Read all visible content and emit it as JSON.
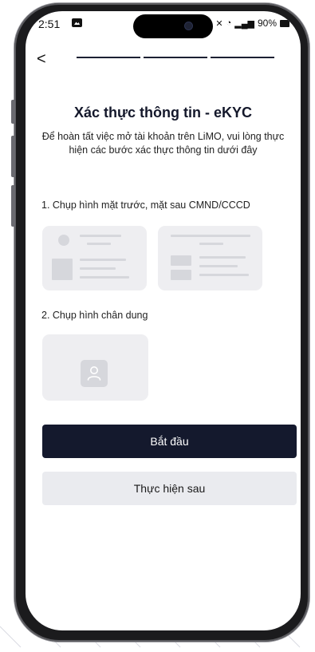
{
  "status_bar": {
    "time": "2:51",
    "battery": "90%",
    "icons": [
      "gallery-icon",
      "mute-icon",
      "wifi-icon",
      "signal-icon",
      "battery-icon"
    ]
  },
  "header": {
    "back_label": "<",
    "progress_steps": 3,
    "current_step": 1
  },
  "page": {
    "title": "Xác thực thông tin - eKYC",
    "subtitle": "Để hoàn tất việc mở tài khoản trên LiMO, vui lòng thực hiện các bước xác thực thông tin dưới đây"
  },
  "steps": [
    {
      "label": "1. Chụp hình mặt trước, mặt sau CMND/CCCD"
    },
    {
      "label": "2. Chụp hình chân dung"
    }
  ],
  "actions": {
    "primary_label": "Bắt đầu",
    "secondary_label": "Thực hiện sau"
  },
  "colors": {
    "primary": "#14192d",
    "secondary_bg": "#eaebef",
    "placeholder_card": "#eeeef1",
    "placeholder_shape": "#d6d7dc"
  }
}
